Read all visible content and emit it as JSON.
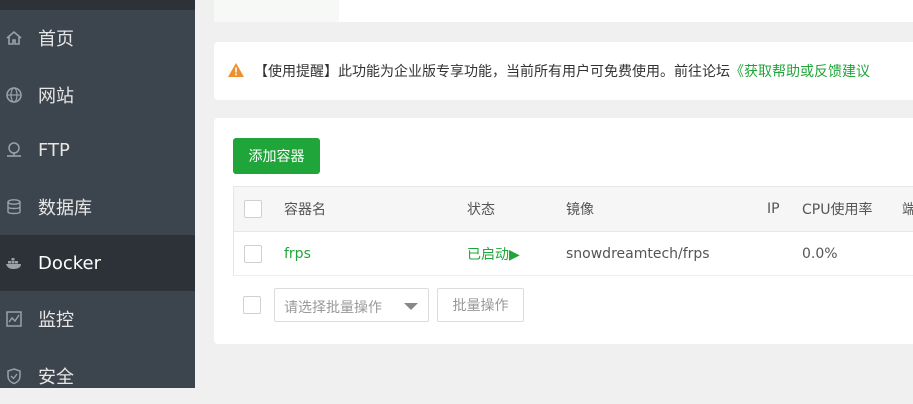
{
  "sidebar": {
    "items": [
      {
        "label": "首页",
        "icon": "home-icon"
      },
      {
        "label": "网站",
        "icon": "globe-icon"
      },
      {
        "label": "FTP",
        "icon": "ftp-icon"
      },
      {
        "label": "数据库",
        "icon": "database-icon"
      },
      {
        "label": "Docker",
        "icon": "docker-icon",
        "active": true
      },
      {
        "label": "监控",
        "icon": "monitor-icon"
      },
      {
        "label": "安全",
        "icon": "shield-icon"
      }
    ]
  },
  "notice": {
    "text": "【使用提醒】此功能为企业版专享功能，当前所有用户可免费使用。前往论坛",
    "link": "《获取帮助或反馈建议"
  },
  "main": {
    "add_button": "添加容器",
    "table": {
      "headers": [
        "容器名",
        "状态",
        "镜像",
        "IP",
        "CPU使用率",
        "端"
      ],
      "rows": [
        {
          "name": "frps",
          "status": "已启动▶",
          "image": "snowdreamtech/frps",
          "ip": "",
          "cpu": "0.0%"
        }
      ]
    },
    "batch_select_placeholder": "请选择批量操作",
    "batch_button": "批量操作"
  },
  "colors": {
    "accent": "#20a53a",
    "sidebar_bg": "#3c444d",
    "sidebar_active": "#2c3238",
    "warning": "#f0902c"
  }
}
